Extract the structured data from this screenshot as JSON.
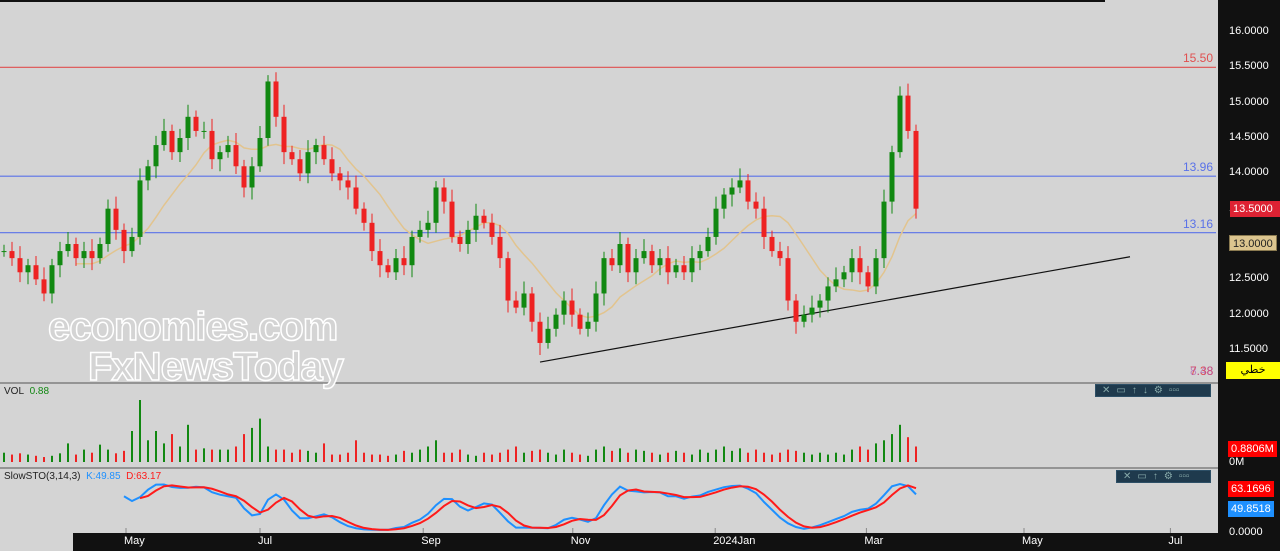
{
  "chart_data": {
    "type": "candlestick",
    "price_axis": {
      "ticks": [
        "16.0000",
        "15.5000",
        "15.0000",
        "14.5000",
        "14.0000",
        "13.5000",
        "13.0000",
        "12.5000",
        "12.0000",
        "11.5000"
      ],
      "range": [
        11.5,
        16.0
      ]
    },
    "time_axis": {
      "labels": [
        "May",
        "Jul",
        "Sep",
        "Nov",
        "2024Jan",
        "Mar",
        "May",
        "Jul"
      ],
      "label_index": [
        15.25,
        32,
        52.4,
        71.1,
        88.9,
        107.8,
        127.5,
        145.8
      ]
    },
    "closes": [
      12.9,
      12.8,
      12.6,
      12.7,
      12.5,
      12.3,
      12.7,
      12.9,
      13.0,
      12.8,
      12.9,
      12.8,
      13.0,
      13.5,
      13.2,
      12.9,
      13.1,
      13.9,
      14.1,
      14.4,
      14.6,
      14.3,
      14.5,
      14.8,
      14.6,
      14.6,
      14.2,
      14.3,
      14.4,
      14.1,
      13.8,
      14.1,
      14.5,
      15.3,
      14.8,
      14.3,
      14.2,
      14.0,
      14.3,
      14.4,
      14.2,
      14.0,
      13.9,
      13.8,
      13.5,
      13.3,
      12.9,
      12.7,
      12.6,
      12.8,
      12.7,
      13.1,
      13.2,
      13.3,
      13.8,
      13.6,
      13.1,
      13.0,
      13.2,
      13.4,
      13.3,
      13.1,
      12.8,
      12.2,
      12.1,
      12.3,
      11.9,
      11.6,
      11.8,
      12.0,
      12.2,
      12.0,
      11.8,
      11.9,
      12.3,
      12.8,
      12.7,
      13.0,
      12.6,
      12.8,
      12.9,
      12.7,
      12.8,
      12.6,
      12.7,
      12.6,
      12.8,
      12.9,
      13.1,
      13.5,
      13.7,
      13.8,
      13.9,
      13.6,
      13.5,
      13.1,
      12.9,
      12.8,
      12.2,
      11.9,
      12.0,
      12.1,
      12.2,
      12.4,
      12.5,
      12.6,
      12.8,
      12.6,
      12.4,
      12.8,
      13.6,
      14.3,
      15.1,
      14.6,
      13.5
    ],
    "volumes": [
      0.15,
      0.12,
      0.14,
      0.12,
      0.1,
      0.08,
      0.1,
      0.14,
      0.3,
      0.12,
      0.2,
      0.15,
      0.28,
      0.2,
      0.14,
      0.18,
      0.5,
      1.0,
      0.35,
      0.5,
      0.3,
      0.45,
      0.25,
      0.6,
      0.2,
      0.22,
      0.2,
      0.2,
      0.2,
      0.25,
      0.45,
      0.55,
      0.7,
      0.25,
      0.2,
      0.2,
      0.15,
      0.2,
      0.18,
      0.15,
      0.3,
      0.12,
      0.12,
      0.15,
      0.35,
      0.15,
      0.12,
      0.12,
      0.1,
      0.12,
      0.18,
      0.15,
      0.2,
      0.25,
      0.35,
      0.15,
      0.15,
      0.2,
      0.12,
      0.1,
      0.15,
      0.12,
      0.15,
      0.2,
      0.25,
      0.15,
      0.18,
      0.2,
      0.15,
      0.12,
      0.2,
      0.15,
      0.12,
      0.1,
      0.2,
      0.25,
      0.18,
      0.22,
      0.15,
      0.2,
      0.18,
      0.15,
      0.12,
      0.15,
      0.18,
      0.15,
      0.12,
      0.2,
      0.15,
      0.2,
      0.25,
      0.18,
      0.22,
      0.15,
      0.2,
      0.15,
      0.12,
      0.15,
      0.2,
      0.18,
      0.15,
      0.12,
      0.15,
      0.12,
      0.15,
      0.12,
      0.2,
      0.25,
      0.2,
      0.3,
      0.35,
      0.45,
      0.6,
      0.4,
      0.25
    ],
    "ma_period": 10,
    "horizontal_lines": [
      {
        "price": 15.5,
        "label": "15.50",
        "color": "#e05050"
      },
      {
        "price": 13.96,
        "label": "13.96",
        "color": "#5a72e8"
      },
      {
        "price": 13.16,
        "label": "13.16",
        "color": "#5a72e8"
      }
    ],
    "trendline": [
      {
        "index": 67,
        "price": 11.33
      },
      {
        "index": 140.75,
        "price": 12.82
      }
    ],
    "last_price": "13.5000",
    "ma_value": "13.0000",
    "overlap_labels": [
      "7.38",
      "8.48"
    ],
    "chart_type_button": "خطي",
    "volume_panel": {
      "title": "VOL",
      "value": "0.88",
      "last": "0.8806M",
      "zero": "0M"
    },
    "stoch_panel": {
      "title": "SlowSTO(3,14,3)",
      "k": "K:49.85",
      "d": "D:63.17",
      "k_last": "49.8518",
      "d_last": "63.1696",
      "zero": "0.0000"
    },
    "colors": {
      "up": "#118811",
      "down": "#ee2222",
      "ma": "#e2c48e",
      "k": "#1e90ff",
      "d": "#ff1a1a"
    }
  },
  "watermark": {
    "line1": "economies.com",
    "line2": "FxNewsToday"
  }
}
